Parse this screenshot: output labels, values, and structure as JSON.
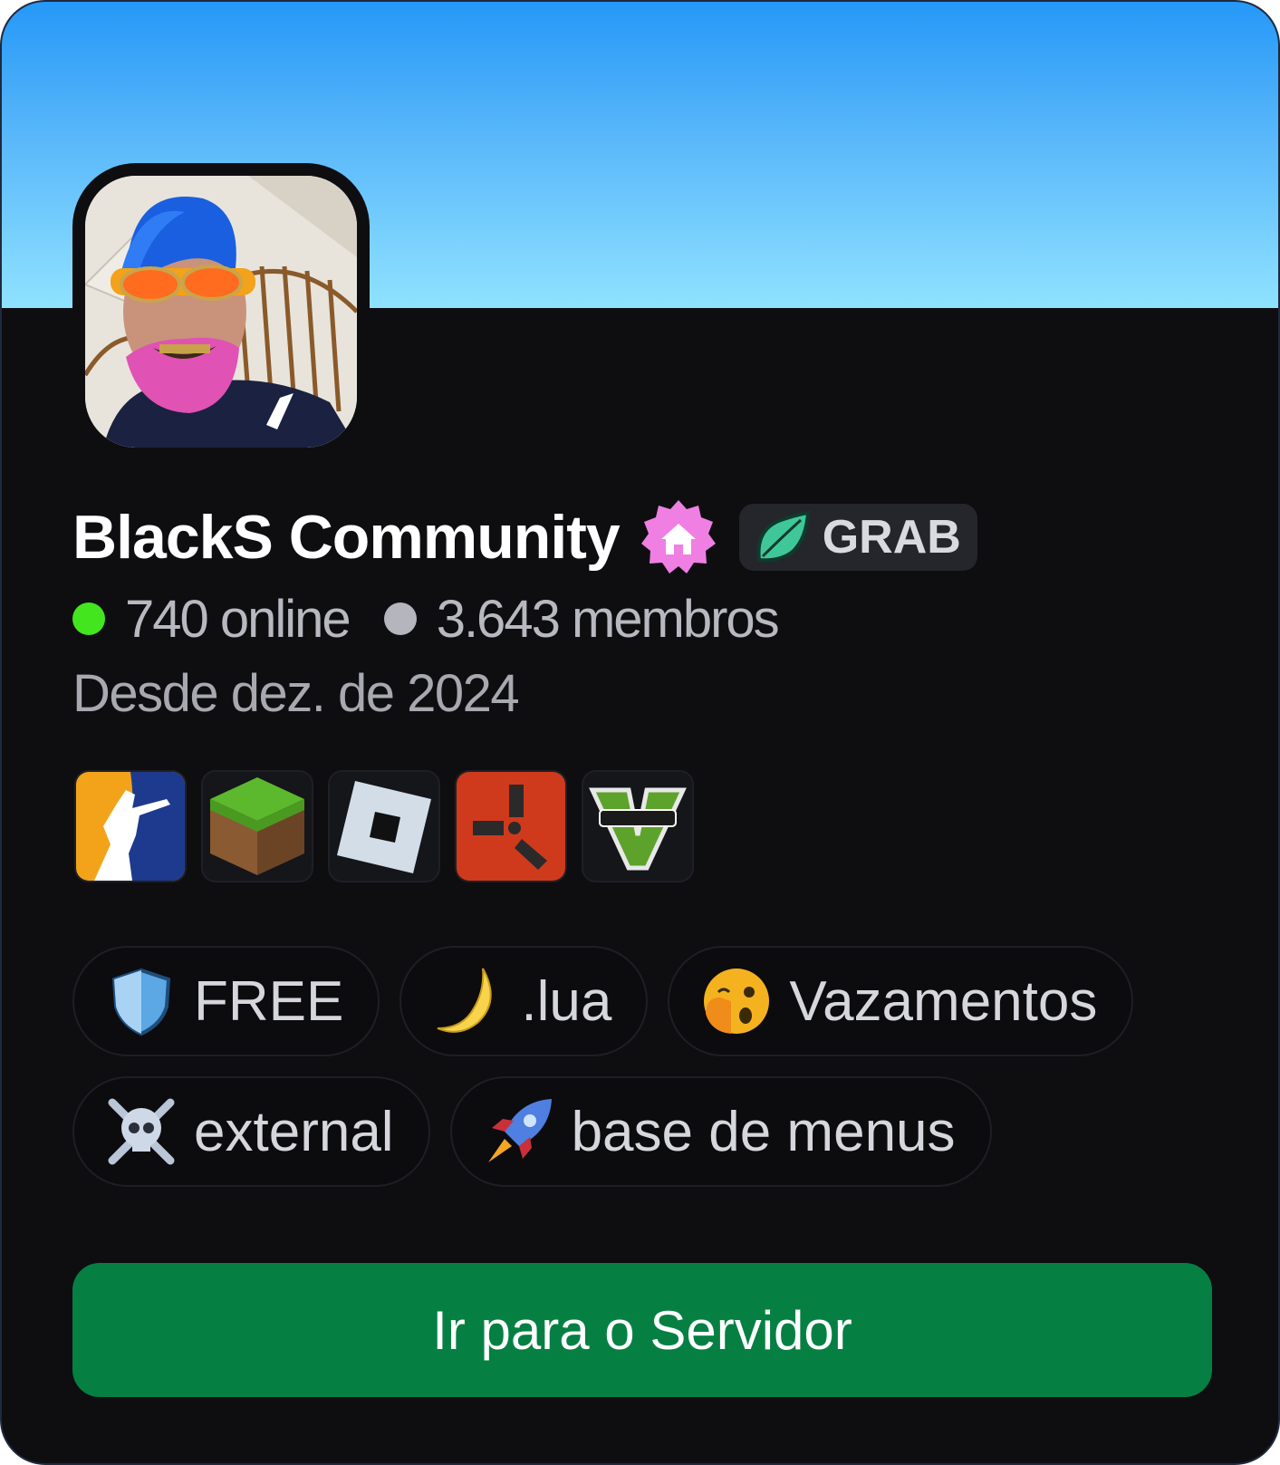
{
  "server": {
    "name": "BlackS Community",
    "badge_tag": "GRAB",
    "online_count": "740 online",
    "member_count": "3.643 membros",
    "since": "Desde dez. de 2024",
    "online_color": "#43e51f",
    "members_color": "#b5b6bd"
  },
  "games": [
    {
      "icon": "counter-strike-icon"
    },
    {
      "icon": "minecraft-icon"
    },
    {
      "icon": "roblox-icon"
    },
    {
      "icon": "rust-icon"
    },
    {
      "icon": "gta-v-icon"
    }
  ],
  "tags": [
    {
      "icon": "shield-icon",
      "label": "FREE"
    },
    {
      "icon": "crescent-moon-icon",
      "label": ".lua"
    },
    {
      "icon": "face-with-hand-over-mouth-icon",
      "label": "Vazamentos"
    },
    {
      "icon": "skull-and-crossbones-icon",
      "label": "external"
    },
    {
      "icon": "rocket-icon",
      "label": "base de menus"
    }
  ],
  "cta": {
    "label": "Ir para o Servidor",
    "color": "#058042"
  }
}
